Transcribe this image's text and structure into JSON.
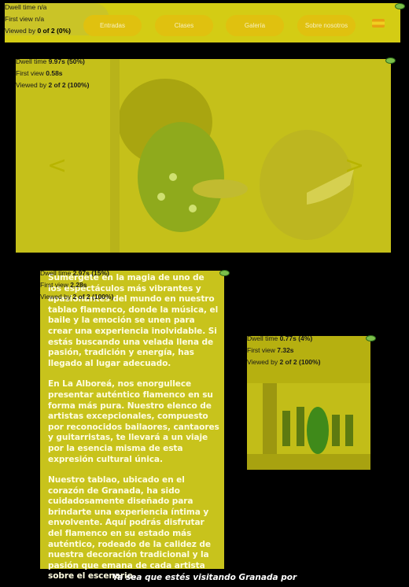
{
  "nav": {
    "items": [
      "Entradas",
      "Clases",
      "Galería",
      "Sobre nosotros"
    ],
    "flag_icon": "spain-flag-icon"
  },
  "heatmaps": {
    "navbar": {
      "dwell_label": "Dwell time",
      "dwell": "n/a",
      "first_label": "First view",
      "first": "n/a",
      "viewed_label": "Viewed by",
      "viewed": "0 of 2 (0%)"
    },
    "carousel": {
      "dwell_label": "Dwell time",
      "dwell": "9.97s (50%)",
      "first_label": "First view",
      "first": "0.58s",
      "viewed_label": "Viewed by",
      "viewed": "2 of 2 (100%)"
    },
    "text": {
      "dwell_label": "Dwell time",
      "dwell": "2.97s (15%)",
      "first_label": "First view",
      "first": "2.28s",
      "viewed_label": "Viewed by",
      "viewed": "2 of 2 (100%)"
    },
    "photo": {
      "dwell_label": "Dwell time",
      "dwell": "0.77s (4%)",
      "first_label": "First view",
      "first": "7.32s",
      "viewed_label": "Viewed by",
      "viewed": "2 of 2 (100%)"
    }
  },
  "carousel": {
    "prev": "<",
    "next": ">"
  },
  "content": {
    "paragraphs": [
      "Sumérgete en la magia de uno de los espectáculos más vibrantes y apasionantes del mundo en nuestro tablao flamenco, donde la música, el baile y la emoción se unen para crear una experiencia inolvidable. Si estás buscando una velada llena de pasión, tradición y energía, has llegado al lugar adecuado.",
      "En La Alboreá, nos enorgullece presentar auténtico flamenco en su forma más pura. Nuestro elenco de artistas excepcionales, compuesto por reconocidos bailaores, cantaores y guitarristas, te llevará a un viaje por la esencia misma de esta expresión cultural única.",
      "Nuestro tablao, ubicado en el corazón de Granada, ha sido cuidadosamente diseñado para brindarte una experiencia íntima y envolvente. Aquí podrás disfrutar del flamenco en su estado más auténtico, rodeado de la calidez de nuestra decoración tradicional y la pasión que emana de cada artista sobre el escenario."
    ],
    "bottom_line": "Ya sea que estés visitando Granada por"
  }
}
